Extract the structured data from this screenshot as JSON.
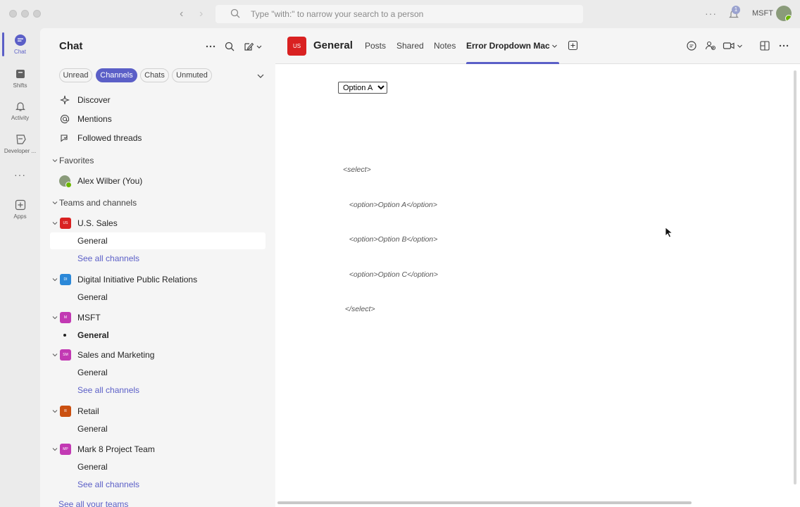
{
  "titlebar": {
    "search_placeholder": "Type \"with:\" to narrow your search to a person",
    "org": "MSFT",
    "notification_count": "1"
  },
  "rail": {
    "items": [
      {
        "label": "Chat",
        "icon": "chat-icon",
        "active": true
      },
      {
        "label": "Shifts",
        "icon": "shifts-icon"
      },
      {
        "label": "Activity",
        "icon": "bell-icon"
      },
      {
        "label": "Developer ...",
        "icon": "developer-portal-icon"
      },
      {
        "label": "Apps",
        "icon": "add-apps-icon"
      }
    ]
  },
  "leftpane": {
    "title": "Chat",
    "filters": [
      "Unread",
      "Channels",
      "Chats",
      "Unmuted"
    ],
    "active_filter": "Channels",
    "quick": [
      {
        "label": "Discover",
        "icon": "sparkle-icon"
      },
      {
        "label": "Mentions",
        "icon": "at-icon"
      },
      {
        "label": "Followed threads",
        "icon": "followed-threads-icon"
      }
    ],
    "favorites_label": "Favorites",
    "favorite_user": "Alex Wilber (You)",
    "teams_label": "Teams and channels",
    "teams": [
      {
        "name": "U.S. Sales",
        "initials": "US",
        "color": "#d92121"
      },
      {
        "name": "Digital Initiative Public Relations",
        "initials": "DI",
        "color": "#2b88d8"
      },
      {
        "name": "MSFT",
        "initials": "M",
        "color": "#c239b3"
      },
      {
        "name": "Sales and Marketing",
        "initials": "SM",
        "color": "#c239b3"
      },
      {
        "name": "Retail",
        "initials": "R",
        "color": "#ca5010"
      },
      {
        "name": "Mark 8 Project Team",
        "initials": "MP",
        "color": "#c239b3"
      }
    ],
    "channel_general": "General",
    "see_all_channels": "See all channels",
    "see_all_teams": "See all your teams"
  },
  "main": {
    "channel_initials": "US",
    "channel_name": "General",
    "tabs": [
      "Posts",
      "Shared",
      "Notes",
      "Error Dropdown Mac"
    ],
    "active_tab": "Error Dropdown Mac",
    "select_value": "Option A",
    "select_options": [
      "Option A",
      "Option B",
      "Option C"
    ],
    "code_lines": [
      "<select>",
      "   <option>Option A</option>",
      "   <option>Option B</option>",
      "   <option>Option C</option>",
      " </select>"
    ]
  },
  "colors": {
    "accent": "#5b5fc7",
    "channel_tile": "#d92121"
  }
}
